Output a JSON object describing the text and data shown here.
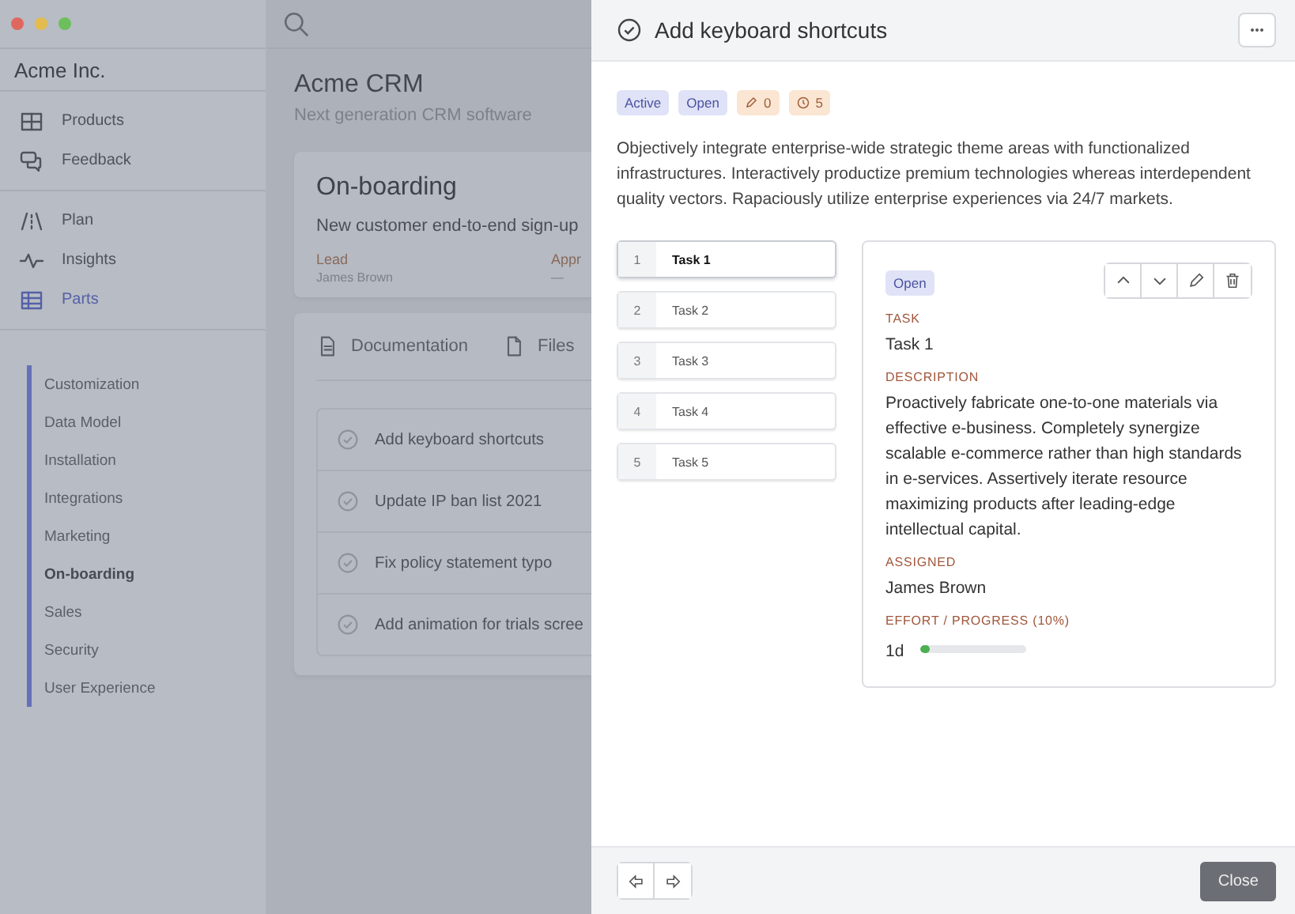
{
  "window_controls": [
    {
      "color": "#e0675f"
    },
    {
      "color": "#e3bb4e"
    },
    {
      "color": "#6cbf5a"
    }
  ],
  "sidebar": {
    "brand": "Acme Inc.",
    "groups": [
      [
        {
          "kind": "grid",
          "label": "Products",
          "selected": false
        },
        {
          "kind": "chat",
          "label": "Feedback",
          "selected": false
        }
      ],
      [
        {
          "kind": "road",
          "label": "Plan",
          "selected": false
        },
        {
          "kind": "pulse",
          "label": "Insights",
          "selected": false
        },
        {
          "kind": "table",
          "label": "Parts",
          "selected": true
        }
      ]
    ],
    "subitems": [
      {
        "label": "Customization",
        "selected": false
      },
      {
        "label": "Data Model",
        "selected": false
      },
      {
        "label": "Installation",
        "selected": false
      },
      {
        "label": "Integrations",
        "selected": false
      },
      {
        "label": "Marketing",
        "selected": false
      },
      {
        "label": "On-boarding",
        "selected": true
      },
      {
        "label": "Sales",
        "selected": false
      },
      {
        "label": "Security",
        "selected": false
      },
      {
        "label": "User Experience",
        "selected": false
      }
    ]
  },
  "main": {
    "title": "Acme CRM",
    "subtitle": "Next generation CRM software",
    "card": {
      "title": "On-boarding",
      "description": "New customer end-to-end sign-up",
      "fields": [
        {
          "label": "Lead",
          "value": "James Brown"
        },
        {
          "label": "Appr",
          "value": "—"
        }
      ]
    },
    "tabs": [
      {
        "kind": "doc",
        "label": "Documentation"
      },
      {
        "kind": "file",
        "label": "Files"
      }
    ],
    "tasks": [
      "Add keyboard shortcuts",
      "Update IP ban list 2021",
      "Fix policy statement typo",
      "Add animation for trials scree"
    ]
  },
  "drawer": {
    "title": "Add keyboard shortcuts",
    "badges": [
      {
        "kind": "status",
        "label": "Active"
      },
      {
        "kind": "status",
        "label": "Open"
      },
      {
        "kind": "subtasks",
        "label": "0"
      },
      {
        "kind": "timer",
        "label": "5"
      }
    ],
    "description": "Objectively integrate enterprise-wide strategic theme areas with functionalized infrastructures. Interactively productize premium technologies whereas interdependent quality vectors. Rapaciously utilize enterprise experiences via 24/7 markets.",
    "tasks": [
      {
        "number": "1",
        "label": "Task 1",
        "selected": true
      },
      {
        "number": "2",
        "label": "Task 2",
        "selected": false
      },
      {
        "number": "3",
        "label": "Task 3",
        "selected": false
      },
      {
        "number": "4",
        "label": "Task 4",
        "selected": false
      },
      {
        "number": "5",
        "label": "Task 5",
        "selected": false
      }
    ],
    "detail": {
      "status": "Open",
      "fields": [
        {
          "label": "TASK",
          "value": "Task 1"
        },
        {
          "label": "DESCRIPTION",
          "value": "Proactively fabricate one-to-one materials via effective e-business. Completely synergize scalable e-commerce rather than high standards in e-services. Assertively iterate resource maximizing products after leading-edge intellectual capital."
        },
        {
          "label": "ASSIGNED",
          "value": "James Brown"
        }
      ],
      "progress": {
        "label": "EFFORT / PROGRESS (10%)",
        "value": "1d",
        "level": 0.1
      }
    },
    "close": "Close"
  }
}
